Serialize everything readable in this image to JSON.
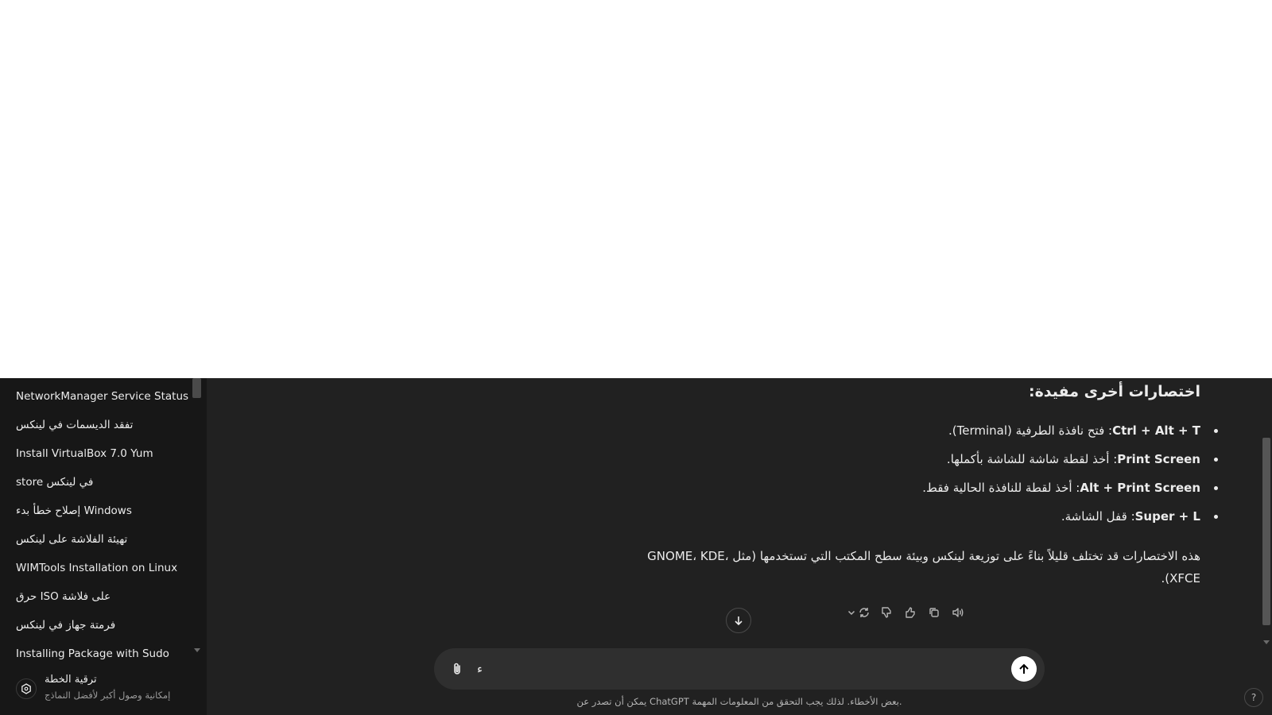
{
  "sidebar": {
    "conversations": [
      "NetworkManager Service Status",
      "تفقد الديسمات في لينكس",
      "Install VirtualBox 7.0 Yum",
      "store في لينكس",
      "إصلاح خطأ بدء Windows",
      "تهيئة الفلاشة على لينكس",
      "WIMTools Installation on Linux",
      "حرق ISO على فلاشة",
      "فرمتة جهاز في لينكس",
      "Installing Package with Sudo"
    ],
    "upgrade": {
      "title": "ترقية الخطة",
      "subtitle": "إمكانية وصول أكبر لأفضل النماذج",
      "icon": "upgrade-icon"
    }
  },
  "message": {
    "heading": "اختصارات أخرى مفيدة:",
    "bullets": [
      {
        "key": "Ctrl + Alt + T",
        "text": ": فتح نافذة الطرفية (Terminal)."
      },
      {
        "key": "Print Screen",
        "text": ": أخذ لقطة شاشة للشاشة بأكملها."
      },
      {
        "key": "Alt + Print Screen",
        "text": ": أخذ لقطة للنافذة الحالية فقط."
      },
      {
        "key": "Super + L",
        "text": ": قفل الشاشة."
      }
    ],
    "paragraph": "هذه الاختصارات قد تختلف قليلاً بناءً على توزيعة لينكس وبيئة سطح المكتب التي تستخدمها (مثل GNOME، KDE، XFCE)."
  },
  "actions": [
    "read-aloud-icon",
    "copy-icon",
    "thumbs-up-icon",
    "thumbs-down-icon",
    "regenerate-icon",
    "chevron-down-icon"
  ],
  "composer": {
    "value": "ء",
    "placeholder": ""
  },
  "disclaimer": "يمكن أن تصدر عن ChatGPT بعض الأخطاء. لذلك يجب التحقق من المعلومات المهمة.",
  "help_label": "?",
  "colors": {
    "background": "#212121",
    "sidebar": "#171717",
    "composer": "#2f2f2f",
    "text": "#ececec"
  }
}
